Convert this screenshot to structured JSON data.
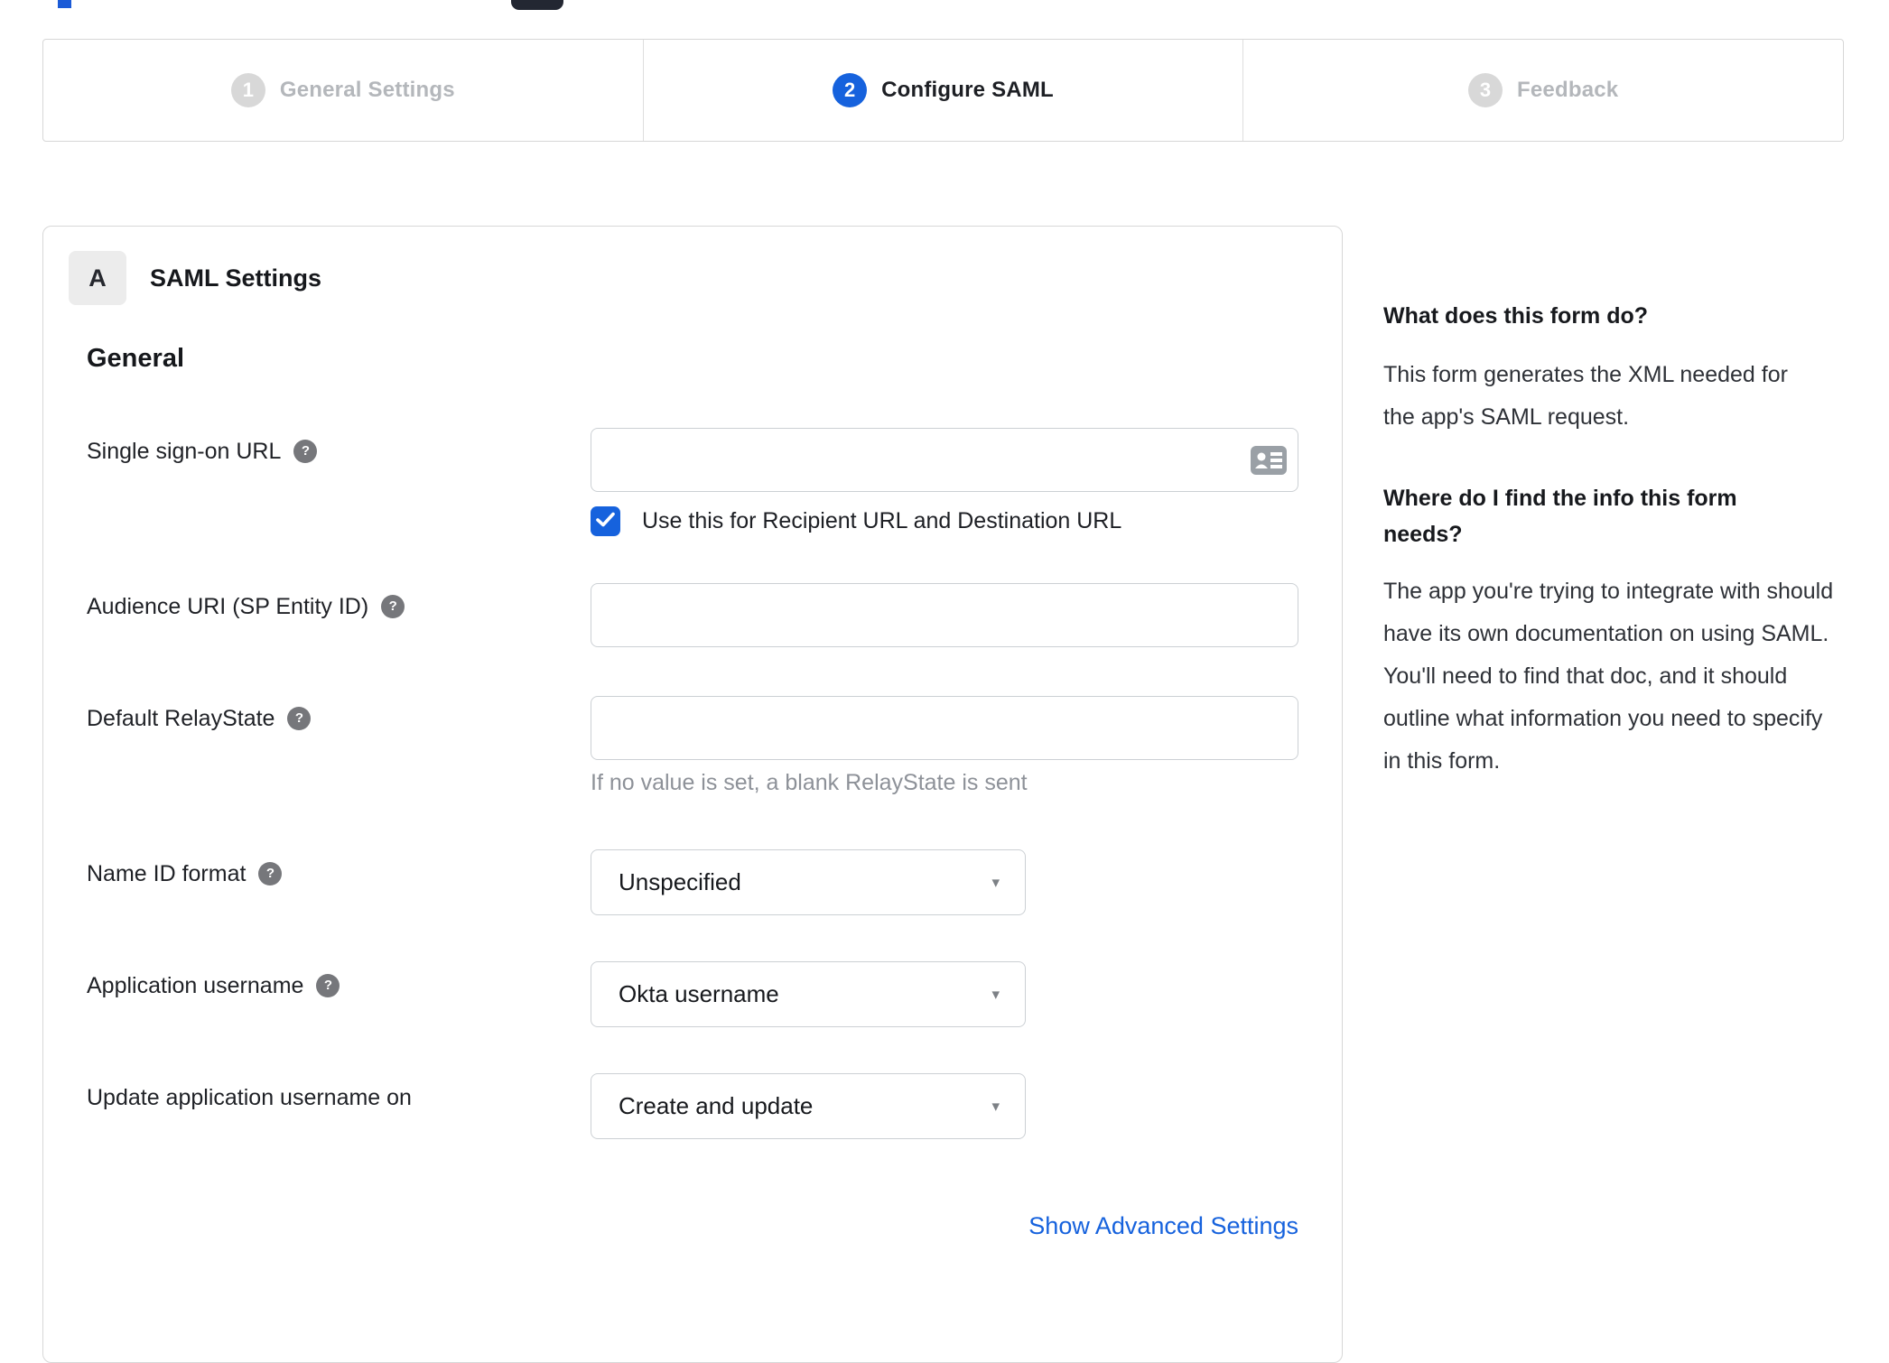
{
  "colors": {
    "accent_blue": "#1662dd",
    "inactive_step_gray": "#b4b7bb",
    "step_circle_gray": "#d8d8d8",
    "border_gray": "#d7d7d7",
    "hint_gray": "#8d9198",
    "text_dark": "#1d1f24"
  },
  "stepper": {
    "steps": [
      {
        "number": "1",
        "label": "General Settings",
        "active": false
      },
      {
        "number": "2",
        "label": "Configure SAML",
        "active": true
      },
      {
        "number": "3",
        "label": "Feedback",
        "active": false
      }
    ]
  },
  "panel": {
    "badge_label": "A",
    "title": "SAML Settings",
    "section_heading": "General",
    "help_glyph": "?",
    "caret_glyph": "▾",
    "fields": [
      {
        "label": "Single sign-on URL",
        "type": "text",
        "value": "",
        "has_help": true,
        "checkbox_label": "Use this for Recipient URL and Destination URL",
        "checkbox_checked": true
      },
      {
        "label": "Audience URI (SP Entity ID)",
        "type": "text",
        "value": "",
        "has_help": true
      },
      {
        "label": "Default RelayState",
        "type": "text",
        "value": "",
        "has_help": true,
        "hint": "If no value is set, a blank RelayState is sent"
      },
      {
        "label": "Name ID format",
        "type": "select",
        "value": "Unspecified",
        "has_help": true
      },
      {
        "label": "Application username",
        "type": "select",
        "value": "Okta username",
        "has_help": true
      },
      {
        "label": "Update application username on",
        "type": "select",
        "value": "Create and update",
        "has_help": false
      }
    ],
    "advanced_settings_link": "Show Advanced Settings"
  },
  "sidebar": {
    "sections": [
      {
        "heading": "What does this form do?",
        "body": "This form generates the XML needed for the app's SAML request."
      },
      {
        "heading": "Where do I find the info this form needs?",
        "body": "The app you're trying to integrate with should have its own documentation on using SAML. You'll need to find that doc, and it should outline what information you need to specify in this form."
      }
    ]
  }
}
